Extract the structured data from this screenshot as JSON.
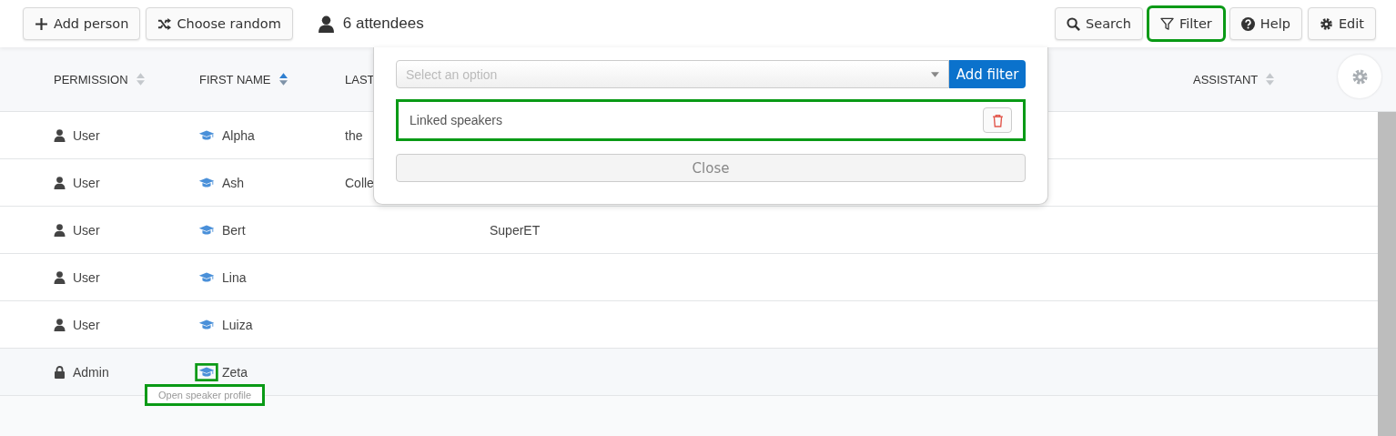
{
  "toolbar_left": [
    {
      "kind": "add",
      "label": "Add person",
      "highlighted": false
    },
    {
      "kind": "shuffle",
      "label": "Choose random",
      "highlighted": false
    }
  ],
  "attendee_count": "6 attendees",
  "toolbar_right": [
    {
      "kind": "search",
      "label": "Search",
      "highlighted": false
    },
    {
      "kind": "filter",
      "label": "Filter",
      "highlighted": true
    },
    {
      "kind": "help",
      "label": "Help",
      "highlighted": false
    },
    {
      "kind": "edit",
      "label": "Edit",
      "highlighted": false
    }
  ],
  "table": {
    "columns": [
      {
        "label": "PERMISSION",
        "sortable": true,
        "sorted": false
      },
      {
        "label": "FIRST NAME",
        "sortable": true,
        "sorted": true
      },
      {
        "label": "LAST"
      },
      {
        "label": "ASSISTANT",
        "sortable": true,
        "sorted": false
      }
    ],
    "rows": [
      {
        "permission": {
          "kind": "user",
          "label": "User"
        },
        "first_name": "Alpha",
        "last_name": "the",
        "column_4": "",
        "hovered": false,
        "icon_highlighted": false
      },
      {
        "permission": {
          "kind": "user",
          "label": "User"
        },
        "first_name": "Ash",
        "last_name": "Colle",
        "column_4": "",
        "hovered": false,
        "icon_highlighted": false
      },
      {
        "permission": {
          "kind": "user",
          "label": "User"
        },
        "first_name": "Bert",
        "last_name": "",
        "column_4": "SuperET",
        "hovered": false,
        "icon_highlighted": false
      },
      {
        "permission": {
          "kind": "user",
          "label": "User"
        },
        "first_name": "Lina",
        "last_name": "",
        "column_4": "",
        "hovered": false,
        "icon_highlighted": false
      },
      {
        "permission": {
          "kind": "user",
          "label": "User"
        },
        "first_name": "Luiza",
        "last_name": "",
        "column_4": "",
        "hovered": false,
        "icon_highlighted": false
      },
      {
        "permission": {
          "kind": "admin",
          "label": "Admin"
        },
        "first_name": "Zeta",
        "last_name": "",
        "column_4": "",
        "hovered": true,
        "icon_highlighted": true
      }
    ]
  },
  "tooltip": {
    "text": "Open speaker profile",
    "highlighted": true
  },
  "filter_popup": {
    "select_placeholder": "Select an option",
    "add_button": "Add filter",
    "filters": [
      {
        "label": "Linked speakers",
        "highlighted": true
      }
    ],
    "close_button": "Close"
  }
}
